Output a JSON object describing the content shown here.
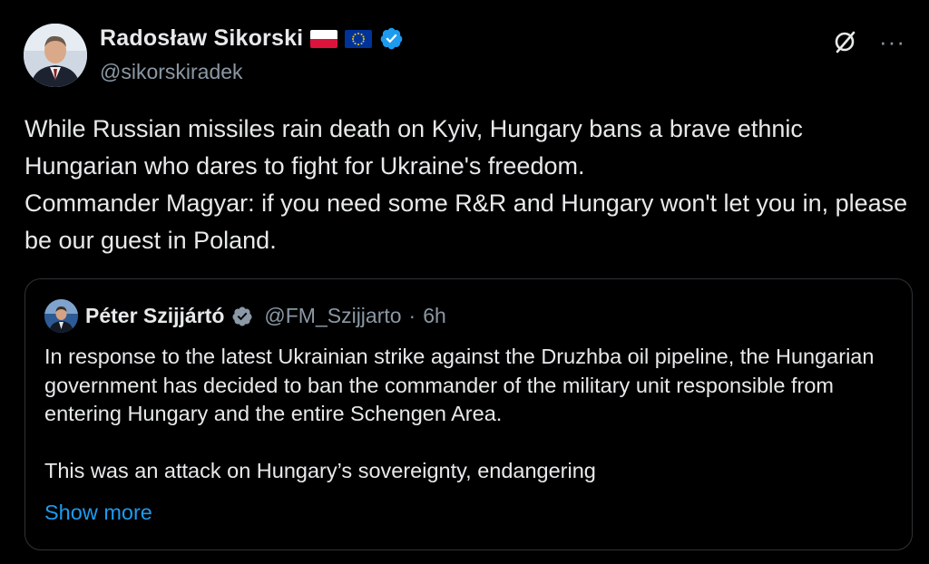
{
  "author": {
    "name": "Radosław Sikorski",
    "handle": "@sikorskiradek",
    "flags": [
      "poland-flag",
      "eu-flag"
    ],
    "verified": true
  },
  "icons": {
    "grok": "grok-icon",
    "more": "more-options-icon",
    "more_glyph": "···"
  },
  "tweet": {
    "lines": [
      "While Russian missiles rain death on Kyiv, Hungary bans a brave ethnic Hungarian who dares to fight for Ukraine's freedom.",
      "Commander Magyar: if you need some R&R and Hungary won't let you in, please be our guest in Poland."
    ]
  },
  "quote": {
    "name": "Péter Szijjártó",
    "handle": "@FM_Szijjarto",
    "separator": "·",
    "time": "6h",
    "verified": true,
    "paragraph1": "In response to the latest Ukrainian strike against the Druzhba oil pipeline, the Hungarian government has decided to ban the commander of the military unit responsible from entering Hungary and the entire Schengen Area.",
    "paragraph2": "This was an attack on Hungary’s sovereignty, endangering",
    "show_more": "Show more"
  },
  "colors": {
    "background": "#000000",
    "text": "#e7e9ea",
    "secondary": "#8b98a5",
    "link": "#1d9bf0",
    "verified": "#1d9bf0",
    "border": "#2f3336"
  }
}
